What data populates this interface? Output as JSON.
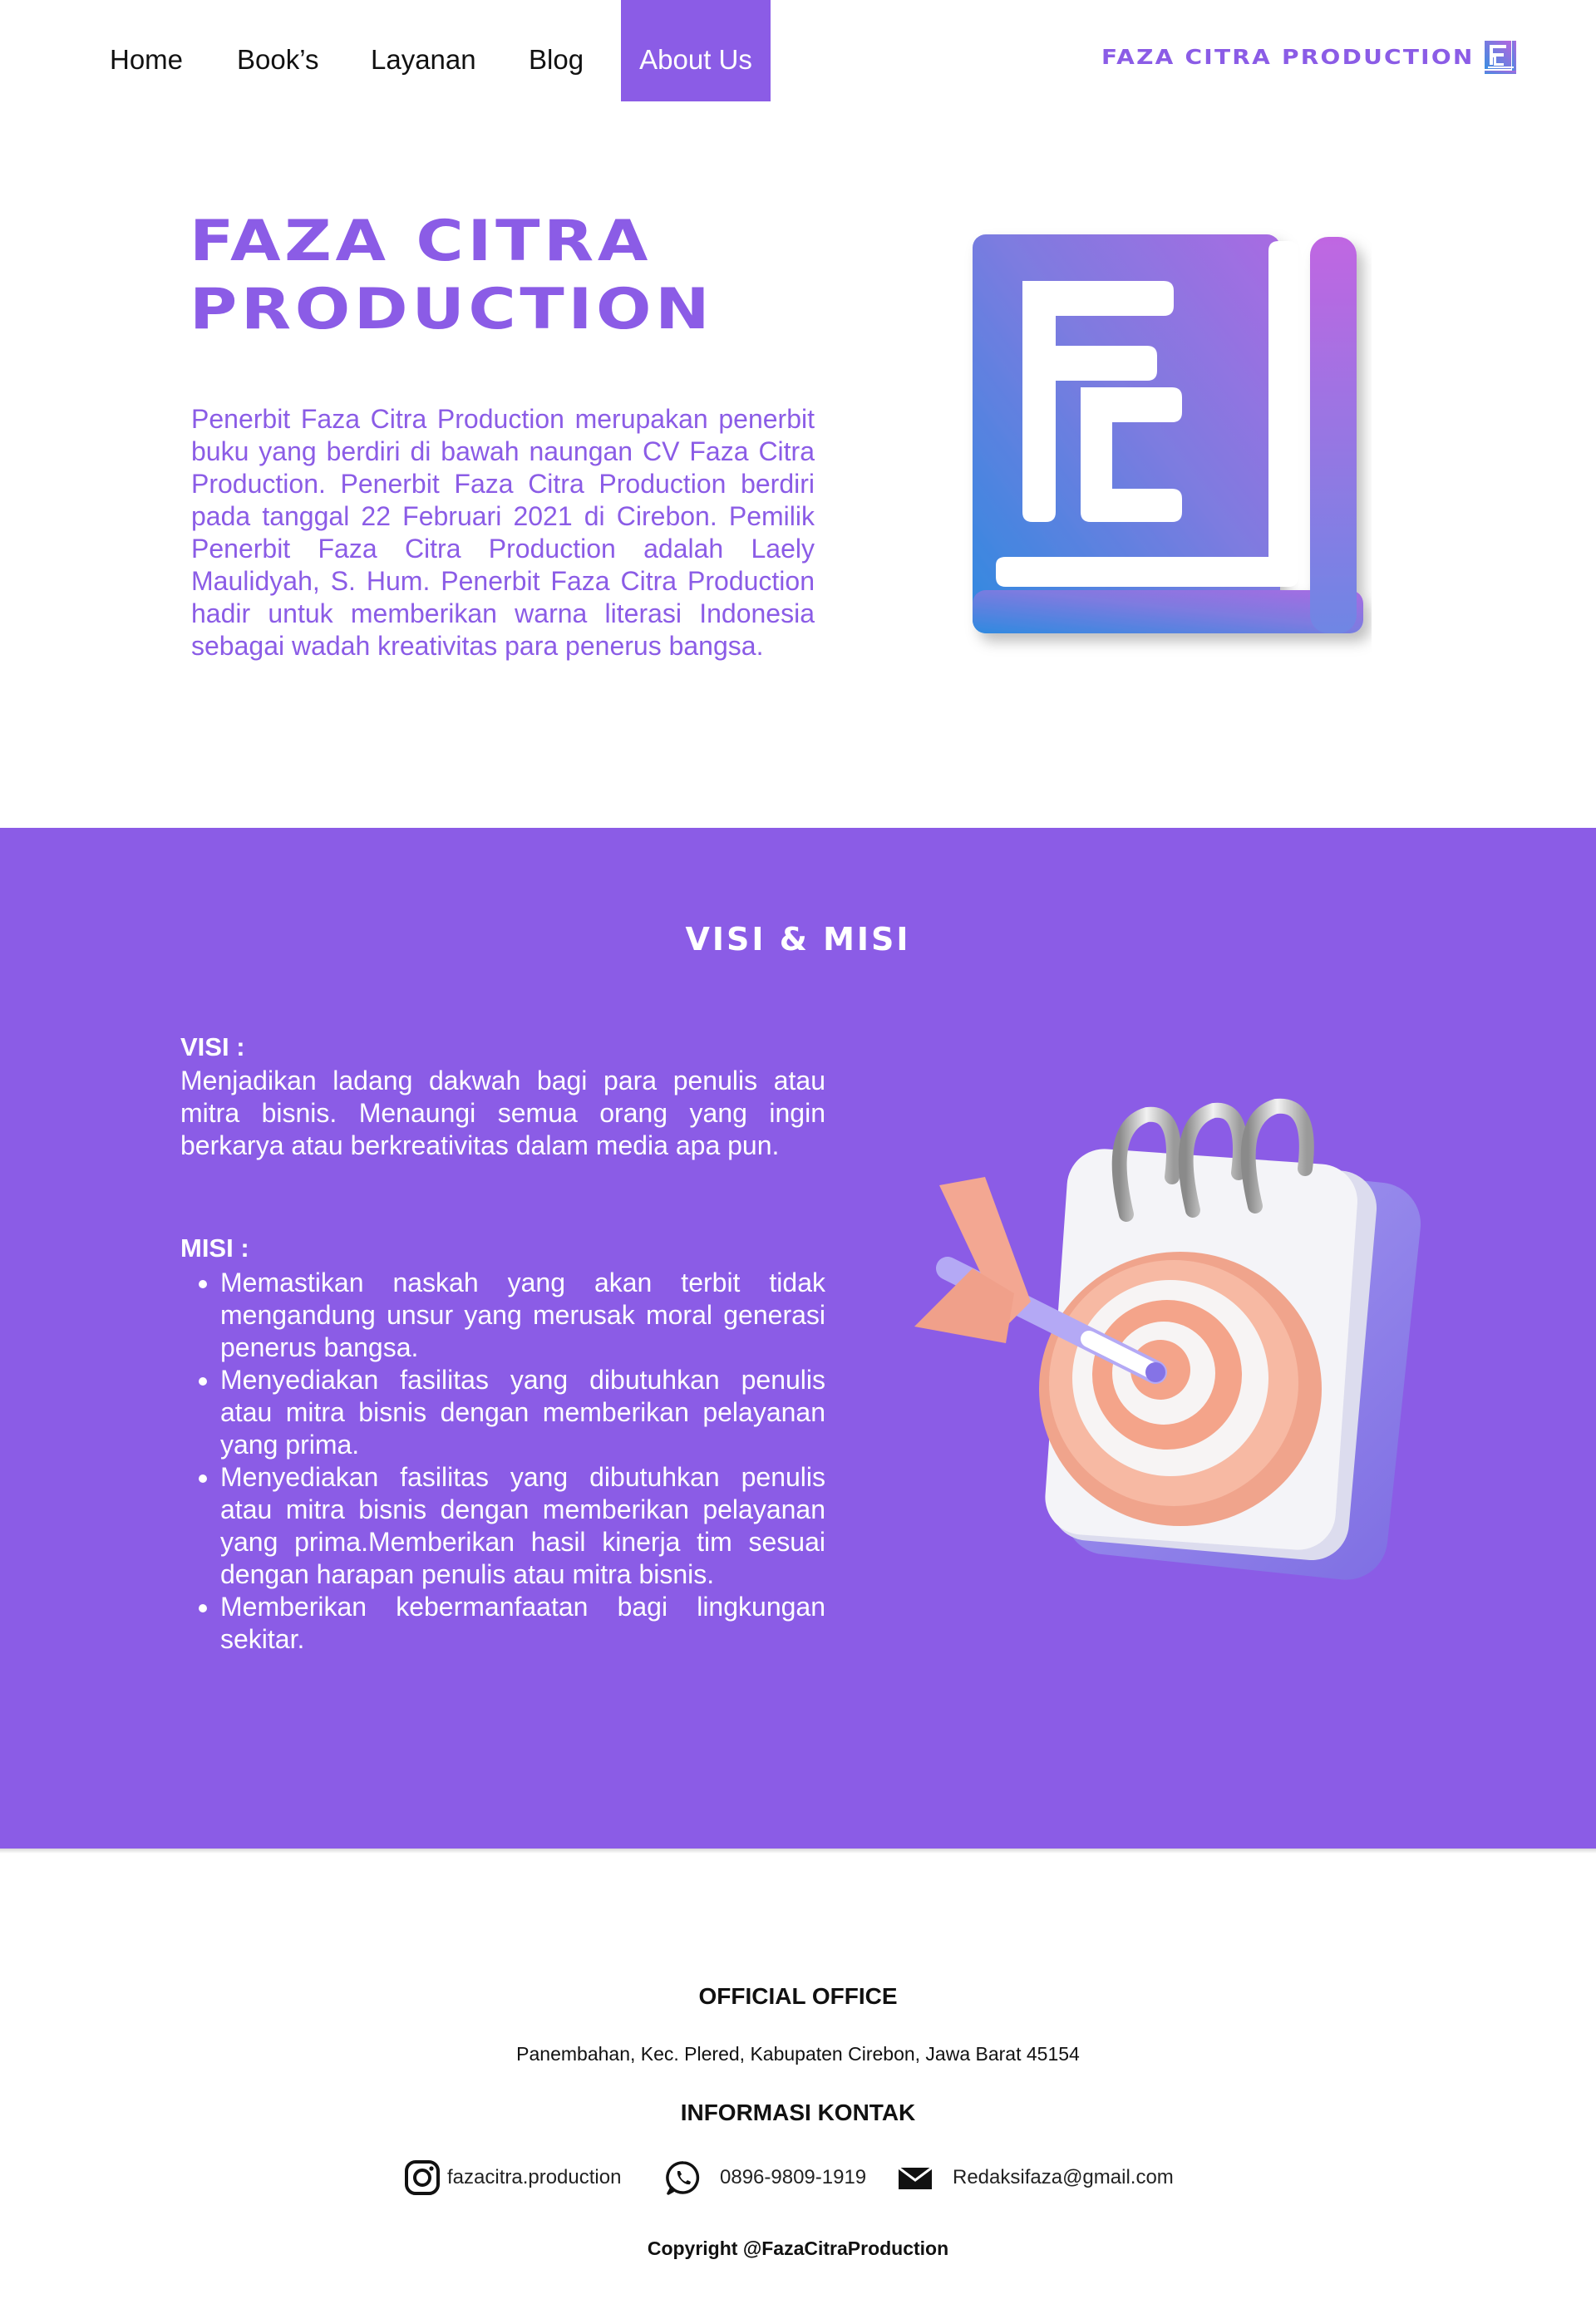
{
  "nav": {
    "items": [
      {
        "label": "Home"
      },
      {
        "label": "Book’s"
      },
      {
        "label": "Layanan"
      },
      {
        "label": "Blog"
      },
      {
        "label": "About Us",
        "active": true
      }
    ],
    "brand": "FAZA CITRA PRODUCTION",
    "brand_icon": "fc-logo-icon"
  },
  "hero": {
    "title_line1": "FAZA CITRA",
    "title_line2": "PRODUCTION",
    "description": "Penerbit Faza Citra Production merupakan penerbit buku yang berdiri di bawah naungan CV Faza Citra Production. Penerbit Faza Citra Production berdiri pada tanggal 22 Februari 2021 di Cirebon. Pemilik Penerbit Faza Citra Production adalah Laely Maulidyah, S. Hum. Penerbit Faza Citra Production hadir untuk memberikan warna literasi Indonesia sebagai wadah kreativitas para penerus bangsa.",
    "logo": "fc-logo-large"
  },
  "visi_misi": {
    "title": "VISI & MISI",
    "visi_label": "VISI :",
    "visi_text": "Menjadikan ladang dakwah bagi para penulis atau mitra bisnis. Menaungi semua orang yang ingin berkarya atau berkreativitas dalam media apa pun.",
    "misi_label": "MISI :",
    "misi_items": [
      "Memastikan naskah yang akan terbit tidak mengandung unsur yang merusak moral generasi penerus bangsa.",
      "Menyediakan fasilitas yang dibutuhkan penulis atau mitra bisnis dengan memberikan pelayanan yang prima.",
      "Menyediakan fasilitas yang dibutuhkan penulis atau mitra bisnis dengan memberikan pelayanan yang prima.Memberikan hasil kinerja tim sesuai dengan harapan penulis atau mitra bisnis.",
      "Memberikan kebermanfaatan bagi lingkungan sekitar."
    ],
    "illustration": "target-calendar-illustration"
  },
  "footer": {
    "office_heading": "OFFICIAL OFFICE",
    "office_address": "Panembahan, Kec. Plered, Kabupaten Cirebon, Jawa Barat 45154",
    "contact_heading": "INFORMASI KONTAK",
    "instagram": "fazacitra.production",
    "whatsapp": "0896-9809-1919",
    "email": "Redaksifaza@gmail.com",
    "copyright": "Copyright @FazaCitraProduction"
  },
  "colors": {
    "accent": "#8b5ce6",
    "white": "#ffffff",
    "text": "#111111"
  }
}
